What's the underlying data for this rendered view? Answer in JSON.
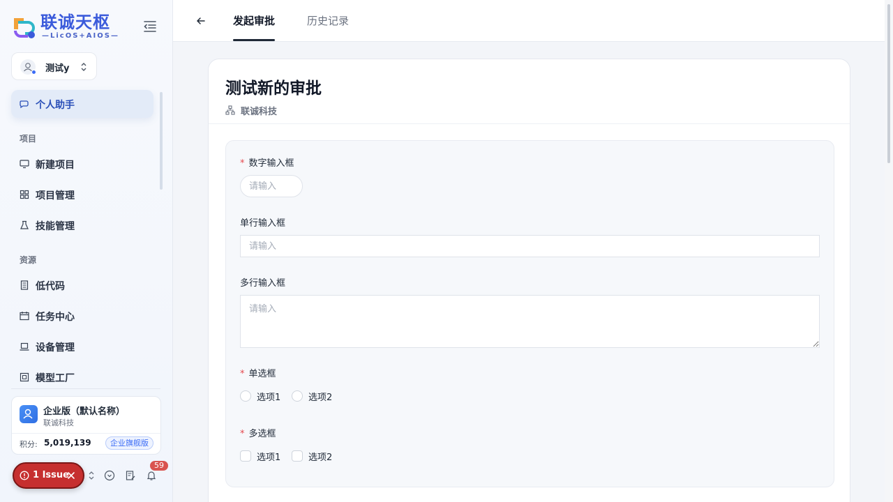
{
  "brand": {
    "title": "联诚天枢",
    "subtitle": "—LicOS+AIOS—",
    "colors": {
      "primary": "#3b5bdb",
      "accent": "#3b6cf6",
      "danger": "#c62f2f"
    }
  },
  "user_selector": {
    "name": "测试y"
  },
  "sidebar": {
    "active_item": {
      "label": "个人助手",
      "icon": "chat-icon"
    },
    "sections": [
      {
        "title": "项目",
        "items": [
          {
            "label": "新建项目",
            "icon": "monitor-icon"
          },
          {
            "label": "项目管理",
            "icon": "grid-icon"
          },
          {
            "label": "技能管理",
            "icon": "flask-icon"
          }
        ]
      },
      {
        "title": "资源",
        "items": [
          {
            "label": "低代码",
            "icon": "document-icon"
          },
          {
            "label": "任务中心",
            "icon": "calendar-icon"
          },
          {
            "label": "设备管理",
            "icon": "laptop-icon"
          },
          {
            "label": "模型工厂",
            "icon": "factory-icon"
          }
        ]
      }
    ]
  },
  "org_card": {
    "name": "企业版（默认名称）",
    "company": "联诚科技",
    "points_label": "积分:",
    "points_value": "5,019,139",
    "plan_badge": "企业旗舰版"
  },
  "footer": {
    "issue_label": "1 Issue",
    "notification_count": "59"
  },
  "topbar": {
    "tabs": [
      {
        "label": "发起审批",
        "active": true
      },
      {
        "label": "历史记录",
        "active": false
      }
    ]
  },
  "form": {
    "title": "测试新的审批",
    "org": "联诚科技",
    "fields": {
      "number": {
        "label": "数字输入框",
        "required": true,
        "placeholder": "请输入"
      },
      "single_line": {
        "label": "单行输入框",
        "required": false,
        "placeholder": "请输入"
      },
      "multi_line": {
        "label": "多行输入框",
        "required": false,
        "placeholder": "请输入"
      },
      "radio": {
        "label": "单选框",
        "required": true,
        "options": [
          "选项1",
          "选项2"
        ]
      },
      "checkbox": {
        "label": "多选框",
        "required": true,
        "options": [
          "选项1",
          "选项2"
        ]
      }
    }
  }
}
